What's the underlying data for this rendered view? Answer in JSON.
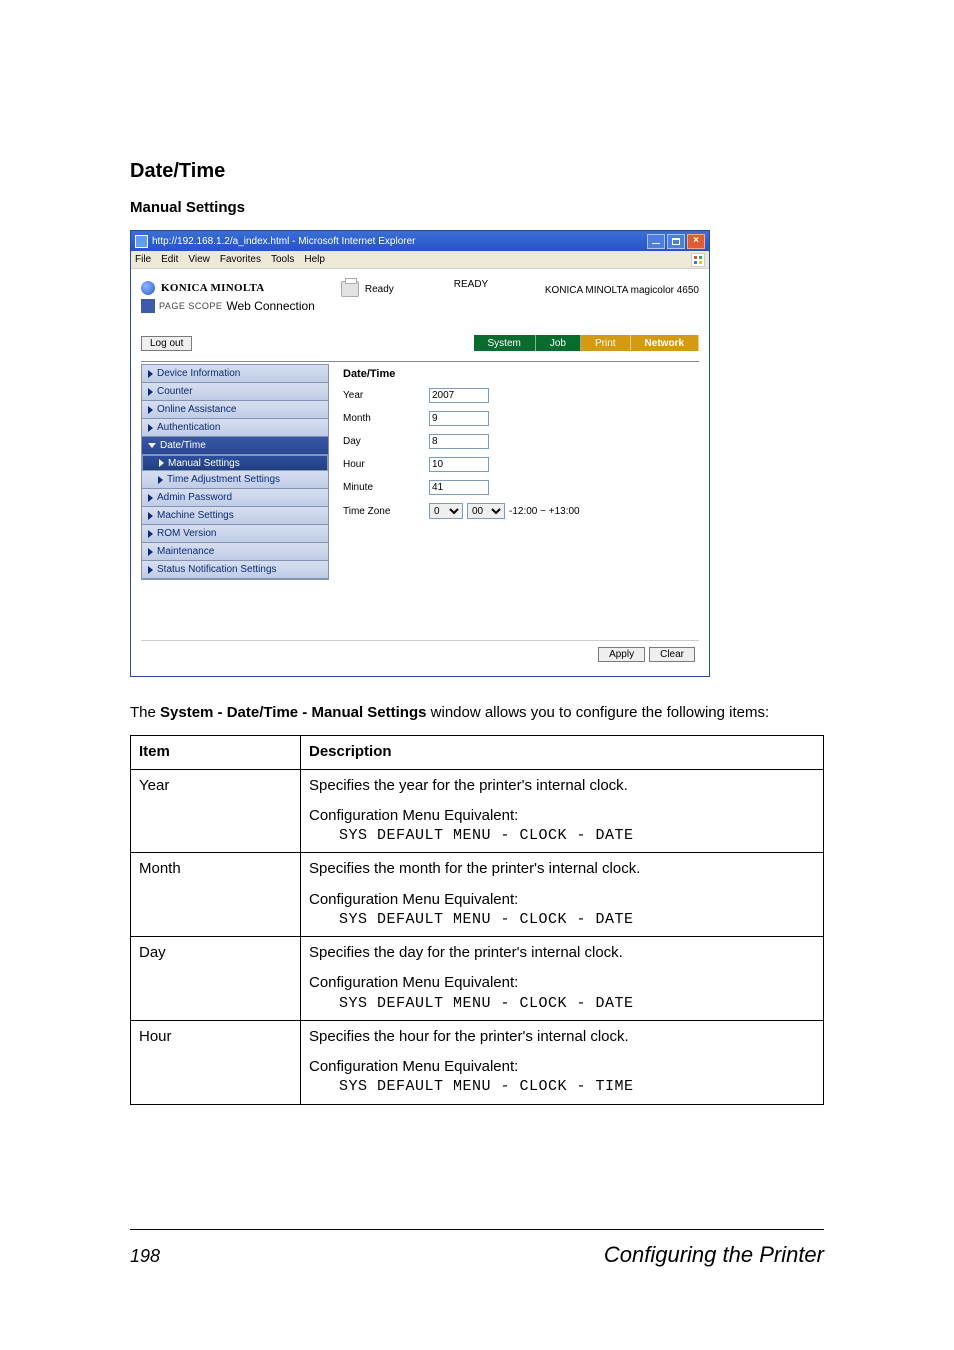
{
  "headings": {
    "h1": "Date/Time",
    "h2": "Manual Settings"
  },
  "browser": {
    "title": "http://192.168.1.2/a_index.html - Microsoft Internet Explorer",
    "menus": {
      "file": "File",
      "edit": "Edit",
      "view": "View",
      "favorites": "Favorites",
      "tools": "Tools",
      "help": "Help"
    }
  },
  "header": {
    "brand": "KONICA MINOLTA",
    "pagescope_small": "PAGE SCOPE",
    "pagescope": "Web Connection",
    "status_word": "Ready",
    "status_top": "READY",
    "model": "KONICA MINOLTA magicolor 4650",
    "logout": "Log out"
  },
  "tabs": {
    "system": "System",
    "job": "Job",
    "print": "Print",
    "network": "Network"
  },
  "sidebar": {
    "device_info": "Device Information",
    "counter": "Counter",
    "online_assist": "Online Assistance",
    "authentication": "Authentication",
    "datetime": "Date/Time",
    "manual": "Manual Settings",
    "time_adj": "Time Adjustment Settings",
    "admin_pw": "Admin Password",
    "machine": "Machine Settings",
    "rom": "ROM Version",
    "maintenance": "Maintenance",
    "status_notif": "Status Notification Settings"
  },
  "form": {
    "title": "Date/Time",
    "labels": {
      "year": "Year",
      "month": "Month",
      "day": "Day",
      "hour": "Hour",
      "minute": "Minute",
      "tz": "Time Zone"
    },
    "values": {
      "year": "2007",
      "month": "9",
      "day": "8",
      "hour": "10",
      "minute": "41",
      "tz_h": "0",
      "tz_m": "00"
    },
    "tz_range": "-12:00 ~ +13:00",
    "apply": "Apply",
    "clear": "Clear"
  },
  "desc": {
    "pre": "The ",
    "bold": "System - Date/Time - Manual Settings",
    "post": " window allows you to configure the following items:"
  },
  "table": {
    "head_item": "Item",
    "head_desc": "Description",
    "rows": [
      {
        "item": "Year",
        "line1": "Specifies the year for the printer's internal clock.",
        "conf": "Configuration Menu Equivalent:",
        "mono": "SYS DEFAULT MENU - CLOCK - DATE"
      },
      {
        "item": "Month",
        "line1": "Specifies the month for the printer's internal clock.",
        "conf": "Configuration Menu Equivalent:",
        "mono": "SYS DEFAULT MENU - CLOCK - DATE"
      },
      {
        "item": "Day",
        "line1": "Specifies the day for the printer's internal clock.",
        "conf": "Configuration Menu Equivalent:",
        "mono": "SYS DEFAULT MENU - CLOCK - DATE"
      },
      {
        "item": "Hour",
        "line1": "Specifies the hour for the printer's internal clock.",
        "conf": "Configuration Menu Equivalent:",
        "mono": "SYS DEFAULT MENU - CLOCK - TIME"
      }
    ]
  },
  "footer": {
    "page": "198",
    "section": "Configuring the Printer"
  }
}
